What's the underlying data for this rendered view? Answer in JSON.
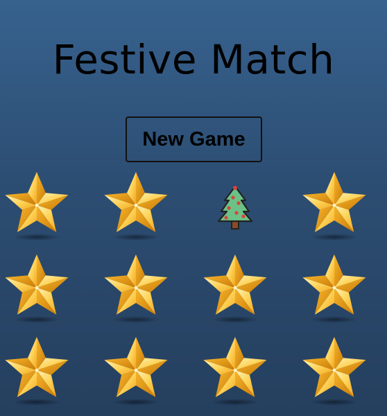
{
  "title": "Festive Match",
  "new_game_label": "New Game",
  "board": {
    "rows": 3,
    "cols": 4,
    "cards": [
      {
        "state": "face-down",
        "icon": "star-icon"
      },
      {
        "state": "face-down",
        "icon": "star-icon"
      },
      {
        "state": "face-up",
        "icon": "christmas-tree-icon"
      },
      {
        "state": "face-down",
        "icon": "star-icon"
      },
      {
        "state": "face-down",
        "icon": "star-icon"
      },
      {
        "state": "face-down",
        "icon": "star-icon"
      },
      {
        "state": "face-down",
        "icon": "star-icon"
      },
      {
        "state": "face-down",
        "icon": "star-icon"
      },
      {
        "state": "face-down",
        "icon": "star-icon"
      },
      {
        "state": "face-down",
        "icon": "star-icon"
      },
      {
        "state": "face-down",
        "icon": "star-icon"
      },
      {
        "state": "face-down",
        "icon": "star-icon"
      }
    ]
  },
  "colors": {
    "background_top": "#37628e",
    "background_bottom": "#253f5e",
    "star_gold": "#f5b431",
    "tree_green": "#4caf50",
    "ornament_red": "#d9433e"
  }
}
